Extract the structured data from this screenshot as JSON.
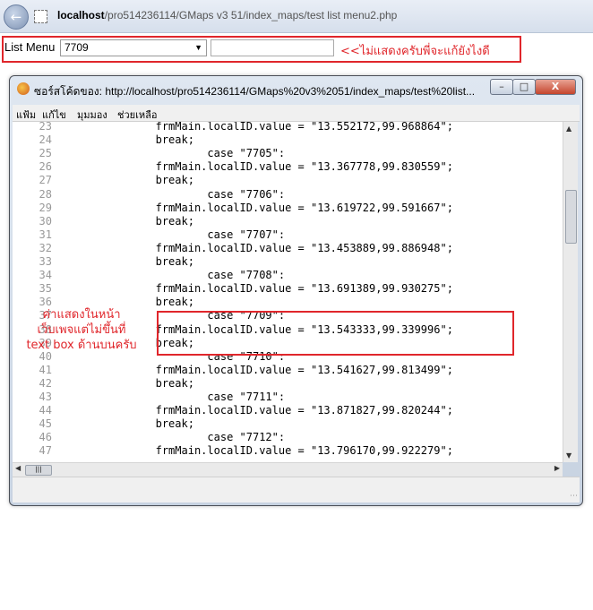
{
  "browser": {
    "url_host": "localhost",
    "url_path": "/pro514236114/GMaps v3 51/index_maps/test list menu2.php"
  },
  "form": {
    "label": "List Menu",
    "selected_value": "7709",
    "textbox_value": ""
  },
  "annotations": {
    "top_note": "<<ไม่แสดงครับพี่จะแก้ยังไงดี",
    "left_note": "ค่าแสดงในหน้าเว็บเพจแต่ไม่ขึ้นที่ text box ด้านบนครับ"
  },
  "source_window": {
    "title": "ซอร์สโค้ดของ: http://localhost/pro514236114/GMaps%20v3%2051/index_maps/test%20list...",
    "menu": [
      "แฟ้ม",
      "แก้ไข",
      "มุมมอง",
      "ช่วยเหลือ"
    ],
    "code_lines": [
      {
        "n": "23",
        "text": "                frmMain.localID.value = \"13.552172,99.968864\";"
      },
      {
        "n": "24",
        "text": "                break;"
      },
      {
        "n": "25",
        "text": "                        case \"7705\":"
      },
      {
        "n": "26",
        "text": "                frmMain.localID.value = \"13.367778,99.830559\";"
      },
      {
        "n": "27",
        "text": "                break;"
      },
      {
        "n": "28",
        "text": "                        case \"7706\":"
      },
      {
        "n": "29",
        "text": "                frmMain.localID.value = \"13.619722,99.591667\";"
      },
      {
        "n": "30",
        "text": "                break;"
      },
      {
        "n": "31",
        "text": "                        case \"7707\":"
      },
      {
        "n": "32",
        "text": "                frmMain.localID.value = \"13.453889,99.886948\";"
      },
      {
        "n": "33",
        "text": "                break;"
      },
      {
        "n": "34",
        "text": "                        case \"7708\":"
      },
      {
        "n": "35",
        "text": "                frmMain.localID.value = \"13.691389,99.930275\";"
      },
      {
        "n": "36",
        "text": "                break;"
      },
      {
        "n": "37",
        "text": "                        case \"7709\":"
      },
      {
        "n": "38",
        "text": "                frmMain.localID.value = \"13.543333,99.339996\";"
      },
      {
        "n": "39",
        "text": "                break;"
      },
      {
        "n": "40",
        "text": "                        case \"7710\":"
      },
      {
        "n": "41",
        "text": "                frmMain.localID.value = \"13.541627,99.813499\";"
      },
      {
        "n": "42",
        "text": "                break;"
      },
      {
        "n": "43",
        "text": "                        case \"7711\":"
      },
      {
        "n": "44",
        "text": "                frmMain.localID.value = \"13.871827,99.820244\";"
      },
      {
        "n": "45",
        "text": "                break;"
      },
      {
        "n": "46",
        "text": "                        case \"7712\":"
      },
      {
        "n": "47",
        "text": "                frmMain.localID.value = \"13.796170,99.922279\";"
      }
    ]
  },
  "icons": {
    "back": "back-arrow-icon",
    "page": "page-icon",
    "firefox": "firefox-icon",
    "minimize": "minimize-icon",
    "maximize": "maximize-icon",
    "close": "close-icon"
  }
}
